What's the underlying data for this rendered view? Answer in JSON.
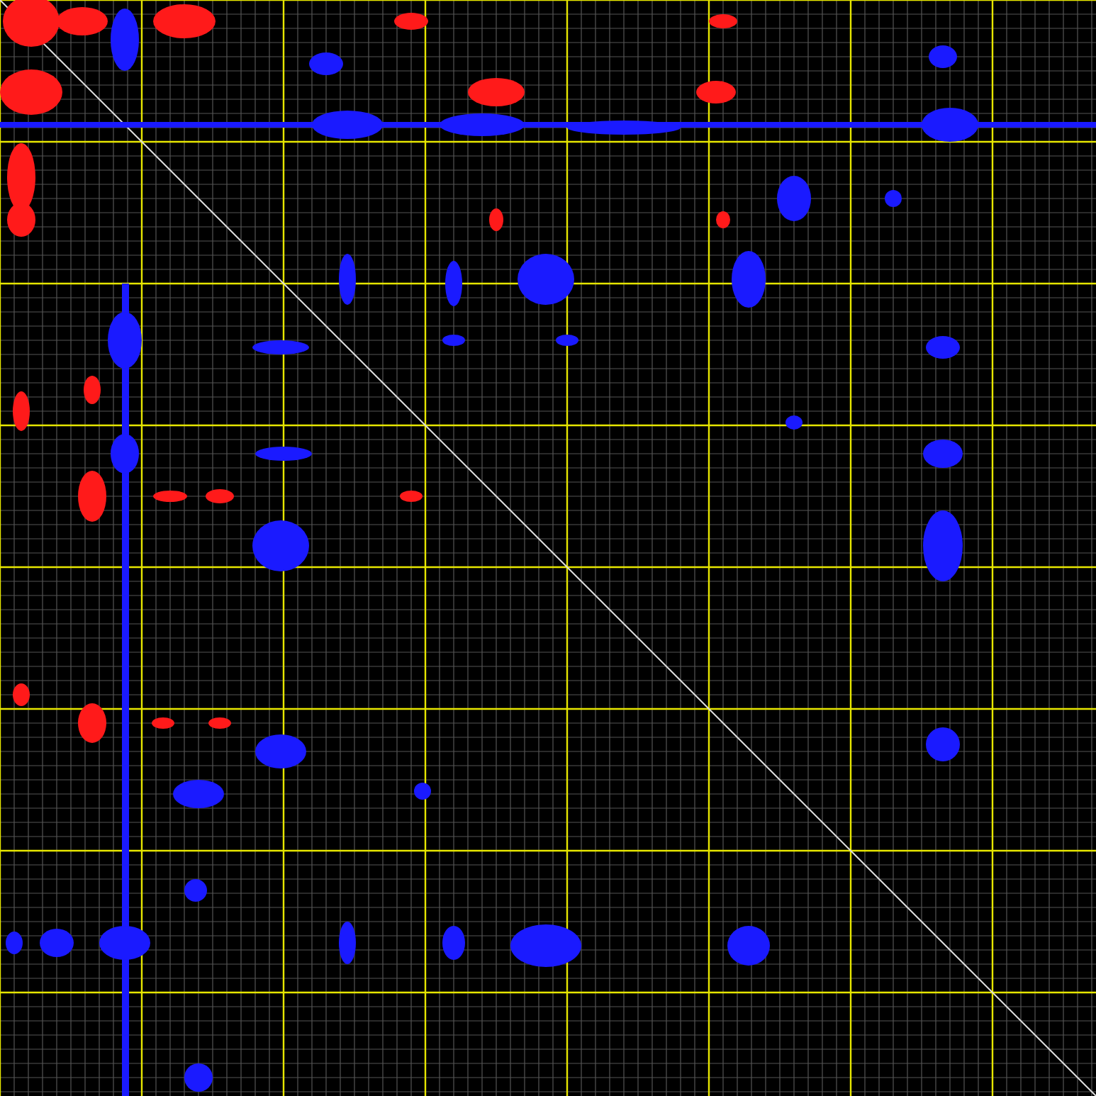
{
  "spectrum_plot": {
    "kind": "contour-map"
  }
}
